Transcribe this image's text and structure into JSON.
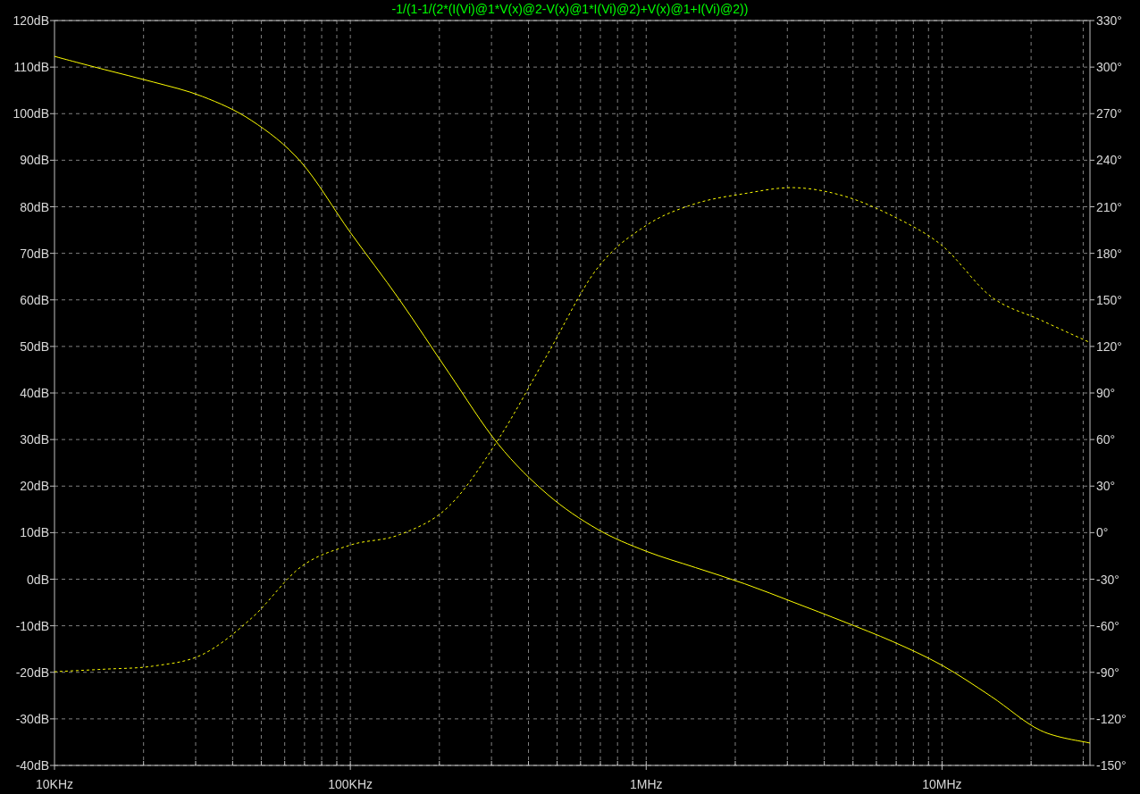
{
  "chart_data": {
    "type": "line",
    "title": "-1/(1-1/(2*(I(Vi)@1*V(x)@2-V(x)@1*I(Vi)@2)+V(x)@1+I(Vi)@2))",
    "categories": [
      "10KHz",
      null,
      null,
      null,
      null,
      null,
      "100KHz",
      null,
      null,
      null,
      null,
      null,
      "1MHz",
      null,
      null,
      null,
      null,
      null,
      "10MHz",
      null,
      null,
      null
    ],
    "series": [
      {
        "color": "#ffff00",
        "line_style": "solid",
        "values": [
          112.3,
          109.5,
          106.8,
          103.7,
          98.5,
          89.6,
          74.5,
          60,
          44.3,
          29,
          18.2,
          10.8,
          6,
          2.5,
          -1,
          -5,
          -9.1,
          -13.4,
          -18.5,
          -25.2,
          -32.5,
          -35.2
        ]
      },
      {
        "color": "#ffff00",
        "axis": "y2",
        "line_style": "dotted",
        "values": [
          -89.6,
          -88,
          -86,
          -78.5,
          -55,
          -22,
          -8,
          -1.3,
          17,
          60,
          115,
          170,
          198,
          212,
          218.5,
          222.3,
          217,
          204,
          185,
          152,
          137,
          122.5
        ]
      }
    ],
    "grid": true,
    "ylim": [
      -40,
      120
    ],
    "y2lim": [
      -150,
      330
    ],
    "yticks": [
      {
        "value": 120,
        "label": "120dB"
      },
      {
        "value": 110,
        "label": "110dB"
      },
      {
        "value": 100,
        "label": "100dB"
      },
      {
        "value": 90,
        "label": "90dB"
      },
      {
        "value": 80,
        "label": "80dB"
      },
      {
        "value": 70,
        "label": "70dB"
      },
      {
        "value": 60,
        "label": "60dB"
      },
      {
        "value": 50,
        "label": "50dB"
      },
      {
        "value": 40,
        "label": "40dB"
      },
      {
        "value": 30,
        "label": "30dB"
      },
      {
        "value": 20,
        "label": "20dB"
      },
      {
        "value": 10,
        "label": "10dB"
      },
      {
        "value": 0,
        "label": "0dB"
      },
      {
        "value": -10,
        "label": "-10dB"
      },
      {
        "value": -20,
        "label": "-20dB"
      },
      {
        "value": -30,
        "label": "-30dB"
      },
      {
        "value": -40,
        "label": "-40dB"
      }
    ],
    "y2ticks": [
      {
        "value": 330,
        "label": "330°"
      },
      {
        "value": 300,
        "label": "300°"
      },
      {
        "value": 270,
        "label": "270°"
      },
      {
        "value": 240,
        "label": "240°"
      },
      {
        "value": 210,
        "label": "210°"
      },
      {
        "value": 180,
        "label": "180°"
      },
      {
        "value": 150,
        "label": "150°"
      },
      {
        "value": 120,
        "label": "120°"
      },
      {
        "value": 90,
        "label": "90°"
      },
      {
        "value": 60,
        "label": "60°"
      },
      {
        "value": 30,
        "label": "30°"
      },
      {
        "value": 0,
        "label": "0°"
      },
      {
        "value": -30,
        "label": "-30°"
      },
      {
        "value": -60,
        "label": "-60°"
      },
      {
        "value": -90,
        "label": "-90°"
      },
      {
        "value": -120,
        "label": "-120°"
      },
      {
        "value": -150,
        "label": "-150°"
      }
    ]
  }
}
